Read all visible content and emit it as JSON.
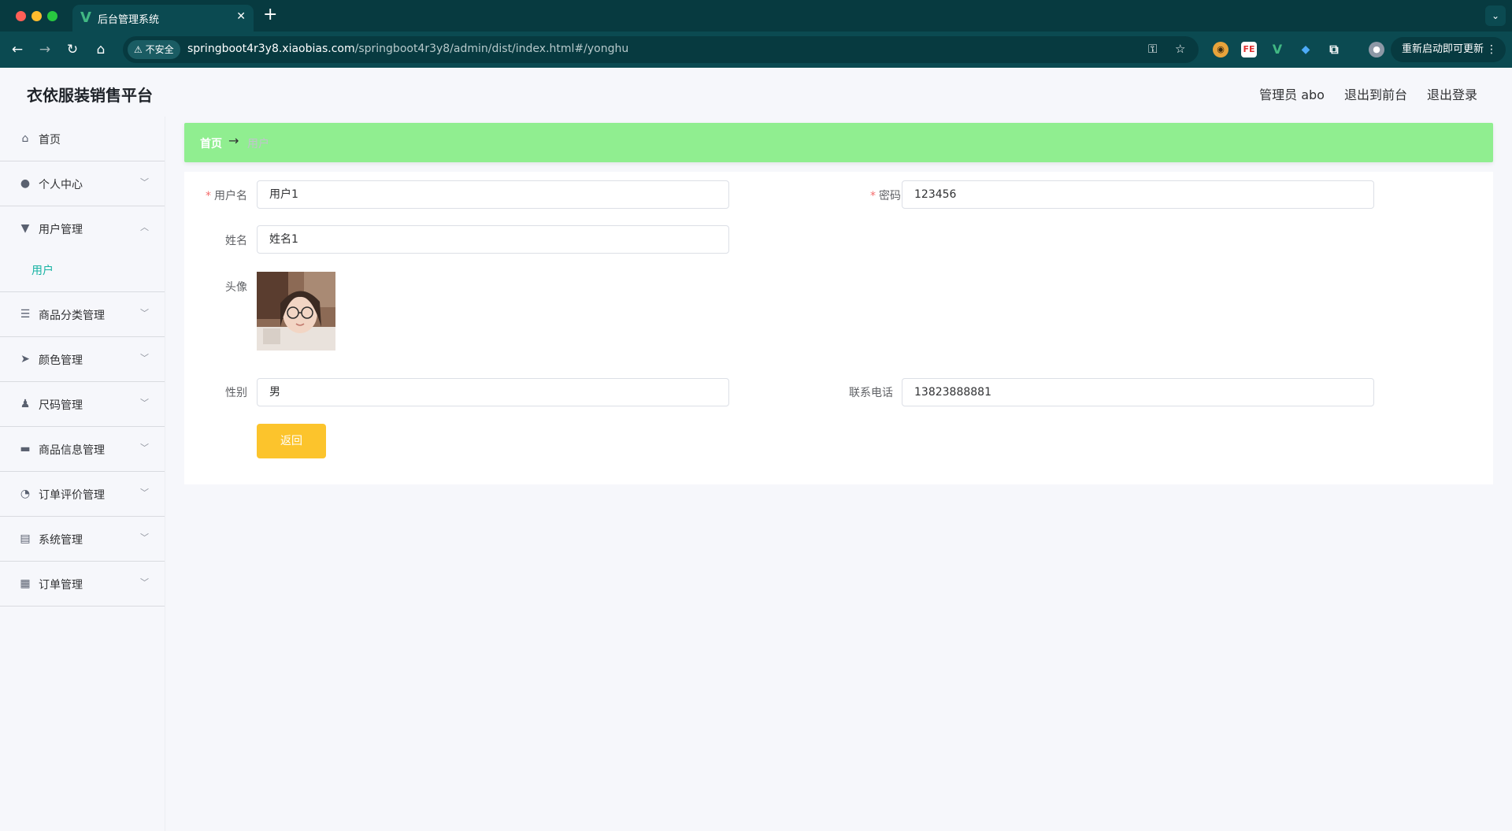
{
  "browser": {
    "tab_title": "后台管理系统",
    "tab_close": "✕",
    "new_tab": "+",
    "security_label": "不安全",
    "url_host": "springboot4r3y8.xiaobias.com",
    "url_path": "/springboot4r3y8/admin/dist/index.html#/yonghu",
    "update_label": "重新启动即可更新",
    "ext_fe_label": "FE",
    "favicon": "V"
  },
  "header": {
    "app_title": "衣依服装销售平台",
    "admin_label": "管理员 abo",
    "to_front_label": "退出到前台",
    "logout_label": "退出登录"
  },
  "sidebar": {
    "items": [
      {
        "label": "首页",
        "icon": "home-icon"
      },
      {
        "label": "个人中心",
        "icon": "user-icon"
      },
      {
        "label": "用户管理",
        "icon": "pin-icon",
        "open": true,
        "sub": [
          "用户"
        ]
      },
      {
        "label": "商品分类管理",
        "icon": "list-icon"
      },
      {
        "label": "颜色管理",
        "icon": "send-icon"
      },
      {
        "label": "尺码管理",
        "icon": "stamp-icon"
      },
      {
        "label": "商品信息管理",
        "icon": "message-icon"
      },
      {
        "label": "订单评价管理",
        "icon": "gauge-icon"
      },
      {
        "label": "系统管理",
        "icon": "clipboard-icon"
      },
      {
        "label": "订单管理",
        "icon": "grid-icon"
      }
    ]
  },
  "breadcrumb": {
    "home": "首页",
    "separator": "→",
    "current": "用户"
  },
  "form": {
    "username_label": "用户名",
    "username_value": "用户1",
    "password_label": "密码",
    "password_value": "123456",
    "name_label": "姓名",
    "name_value": "姓名1",
    "avatar_label": "头像",
    "gender_label": "性别",
    "gender_value": "男",
    "phone_label": "联系电话",
    "phone_value": "13823888881",
    "required_mark": "*",
    "back_label": "返回"
  },
  "colors": {
    "accent": "#17b3a3",
    "breadcrumb_bg": "#90ee90",
    "back_button": "#fcc42c",
    "chrome": "#0b4a51"
  }
}
